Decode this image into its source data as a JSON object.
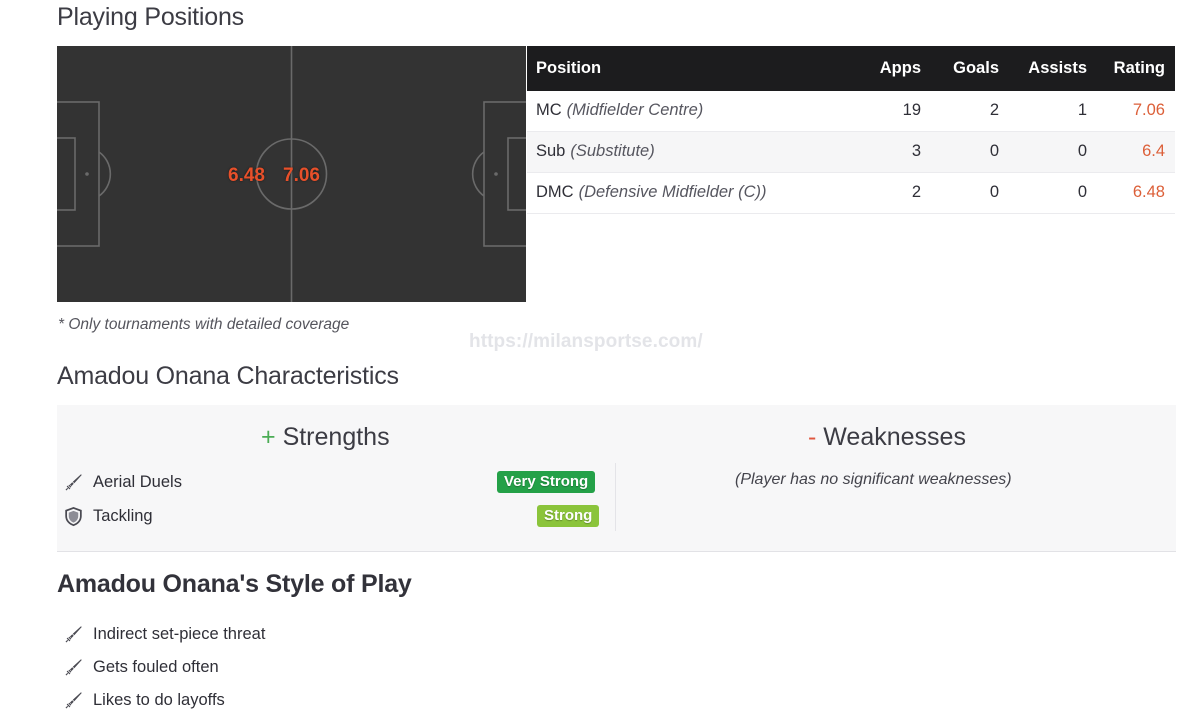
{
  "sections": {
    "playing_positions_title": "Playing Positions",
    "characteristics_title": "Amadou Onana Characteristics",
    "style_title": "Amadou Onana's Style of Play"
  },
  "footnote": "* Only tournaments with detailed coverage",
  "watermark": "https://milansportse.com/",
  "pitch": {
    "name": "football-pitch",
    "background_color": "#333333",
    "line_color": "#6a6a6a",
    "rating_color": "#e8502a",
    "ratings": [
      {
        "value": "6.48",
        "position": "DMC"
      },
      {
        "value": "7.06",
        "position": "MC"
      }
    ]
  },
  "positions_table": {
    "columns": [
      "Position",
      "Apps",
      "Goals",
      "Assists",
      "Rating"
    ],
    "header_bg": "#1c1c1e",
    "rating_color": "#dc5f38",
    "rows": [
      {
        "abbr": "MC",
        "full": "(Midfielder Centre)",
        "apps": "19",
        "goals": "2",
        "assists": "1",
        "rating": "7.06"
      },
      {
        "abbr": "Sub",
        "full": "(Substitute)",
        "apps": "3",
        "goals": "0",
        "assists": "0",
        "rating": "6.4"
      },
      {
        "abbr": "DMC",
        "full": "(Defensive Midfielder (C))",
        "apps": "2",
        "goals": "0",
        "assists": "0",
        "rating": "6.48"
      }
    ]
  },
  "characteristics": {
    "strengths": {
      "plus": "+",
      "word": "Strengths",
      "items": [
        {
          "icon": "sword-icon",
          "label": "Aerial Duels",
          "badge": "Very Strong",
          "badge_color": "#24a148"
        },
        {
          "icon": "shield-icon",
          "label": "Tackling",
          "badge": "Strong",
          "badge_color": "#8bc43b"
        }
      ]
    },
    "weaknesses": {
      "minus": "-",
      "word": "Weaknesses",
      "empty_text": "(Player has no significant weaknesses)"
    }
  },
  "style_of_play": {
    "items": [
      {
        "icon": "sword-icon",
        "label": "Indirect set-piece threat"
      },
      {
        "icon": "sword-icon",
        "label": "Gets fouled often"
      },
      {
        "icon": "sword-icon",
        "label": "Likes to do layoffs"
      }
    ]
  },
  "chart_data": {
    "type": "table",
    "title": "Playing Positions",
    "categories": [
      "MC (Midfielder Centre)",
      "Sub (Substitute)",
      "DMC (Defensive Midfielder (C))"
    ],
    "series": [
      {
        "name": "Apps",
        "values": [
          19,
          3,
          2
        ]
      },
      {
        "name": "Goals",
        "values": [
          2,
          0,
          0
        ]
      },
      {
        "name": "Assists",
        "values": [
          1,
          0,
          0
        ]
      },
      {
        "name": "Rating",
        "values": [
          7.06,
          6.4,
          6.48
        ]
      }
    ],
    "pitch_overlay": [
      {
        "label": "6.48",
        "role": "DMC",
        "x_pct": 41,
        "y_pct": 50
      },
      {
        "label": "7.06",
        "role": "MC",
        "x_pct": 53,
        "y_pct": 50
      }
    ]
  }
}
